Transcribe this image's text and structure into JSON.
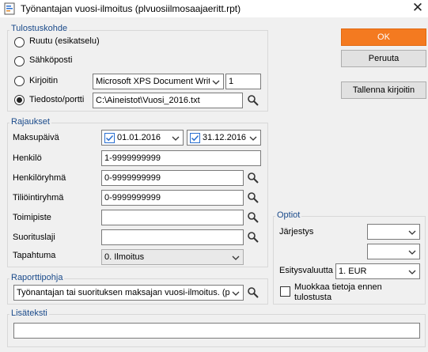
{
  "window": {
    "title": "Työnantajan vuosi-ilmoitus (plvuosiilmosaajaeritt.rpt)",
    "close_glyph": "✕"
  },
  "colors": {
    "accent": "#f47a20",
    "group_label": "#1a4a8a"
  },
  "output": {
    "group_label": "Tulostuskohde",
    "options": [
      {
        "label": "Ruutu (esikatselu)",
        "selected": false
      },
      {
        "label": "Sähköposti",
        "selected": false
      },
      {
        "label": "Kirjoitin",
        "selected": false
      },
      {
        "label": "Tiedosto/portti",
        "selected": true
      }
    ],
    "printer_value": "Microsoft XPS Document Write",
    "copies_value": "1",
    "file_value": "C:\\Aineistot\\Vuosi_2016.txt"
  },
  "buttons": {
    "ok": "OK",
    "cancel": "Peruuta",
    "save_printer": "Tallenna kirjoitin"
  },
  "filters": {
    "group_label": "Rajaukset",
    "payment_date_label": "Maksupäivä",
    "date_from": "01.01.2016",
    "date_from_checked": true,
    "date_to": "31.12.2016",
    "date_to_checked": true,
    "henkilo_label": "Henkilö",
    "henkilo_value": "1-9999999999",
    "henkiloryhma_label": "Henkilöryhmä",
    "henkiloryhma_value": "0-9999999999",
    "tiliointiryhma_label": "Tiliöintiryhmä",
    "tiliointiryhma_value": "0-9999999999",
    "toimipiste_label": "Toimipiste",
    "toimipiste_value": "",
    "suorituslaji_label": "Suorituslaji",
    "suorituslaji_value": "",
    "tapahtuma_label": "Tapahtuma",
    "tapahtuma_value": "0. Ilmoitus"
  },
  "options": {
    "group_label": "Optiot",
    "jarjestys_label": "Järjestys",
    "sort1_value": "",
    "sort2_value": "",
    "currency_label": "Esitysvaluutta",
    "currency_value": "1. EUR",
    "edit_before_print_label": "Muokkaa tietoja ennen tulostusta",
    "edit_before_print_checked": false
  },
  "template": {
    "group_label": "Raporttipohja",
    "value": "Työnantajan tai suorituksen maksajan vuosi-ilmoitus. (pl"
  },
  "extra_text": {
    "group_label": "Lisäteksti",
    "value": ""
  },
  "icons": {
    "search": "magnifier-icon",
    "dropdown": "chevron-down-icon",
    "app": "report-icon",
    "close": "close-icon"
  }
}
